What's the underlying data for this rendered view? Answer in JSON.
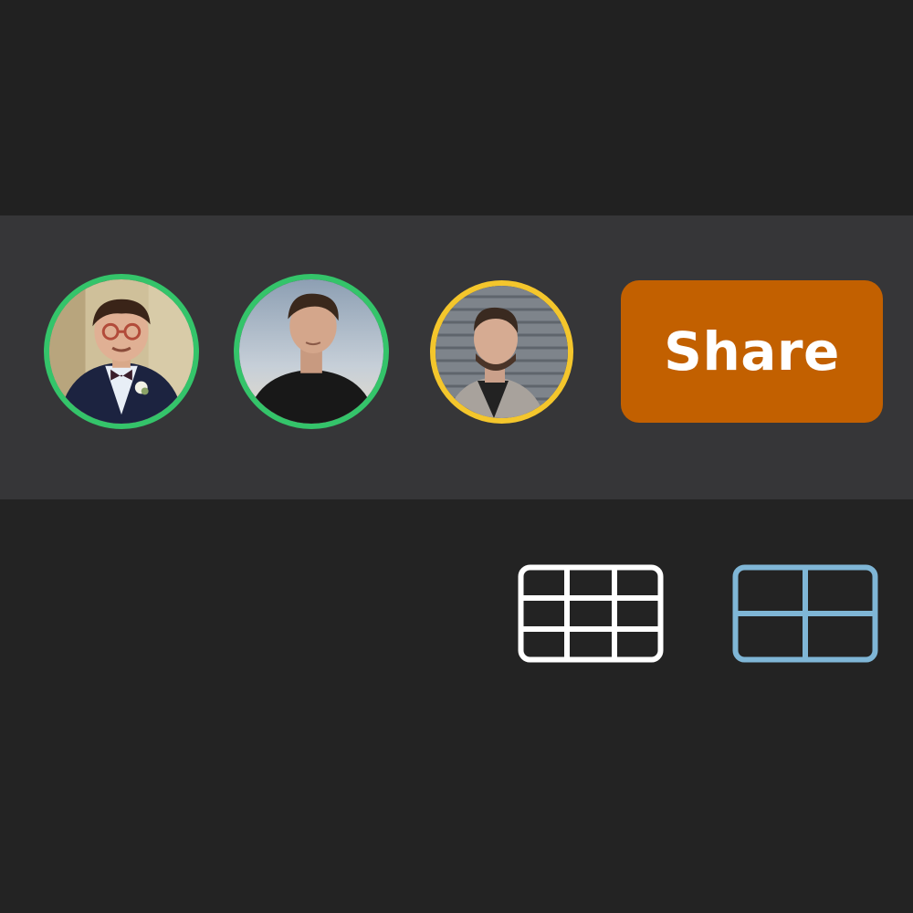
{
  "toolbar": {
    "share_label": "Share",
    "share_color": "#c26000"
  },
  "participants": [
    {
      "name": "participant-1",
      "status_color": "#34c46a",
      "status": "online"
    },
    {
      "name": "participant-2",
      "status_color": "#34c46a",
      "status": "online"
    },
    {
      "name": "participant-3",
      "status_color": "#f4c62c",
      "status": "away"
    }
  ],
  "layout_options": [
    {
      "icon": "grid-3x3-icon",
      "color": "#ffffff",
      "selected": false
    },
    {
      "icon": "grid-2x2-icon",
      "color": "#7fb6d6",
      "selected": true
    }
  ]
}
